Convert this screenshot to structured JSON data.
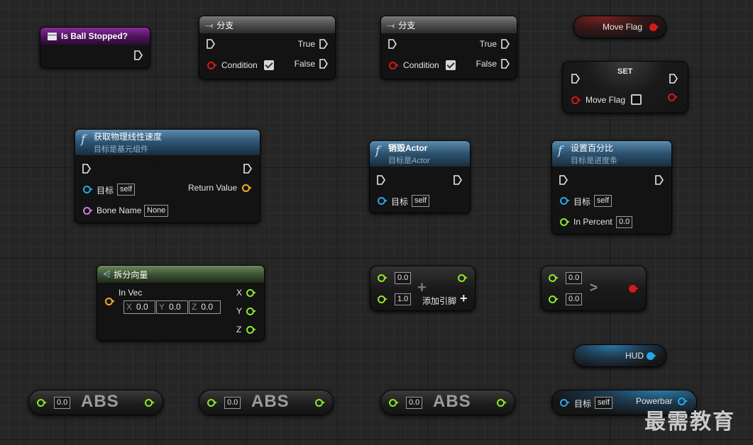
{
  "nodes": {
    "is_ball_stopped": {
      "title": "Is Ball Stopped?"
    },
    "branch1": {
      "title": "分支",
      "true_label": "True",
      "false_label": "False",
      "condition_label": "Condition"
    },
    "branch2": {
      "title": "分支",
      "true_label": "True",
      "false_label": "False",
      "condition_label": "Condition"
    },
    "move_flag_get": {
      "label": "Move Flag"
    },
    "set_move_flag": {
      "title": "SET",
      "var_label": "Move Flag"
    },
    "get_physics_velocity": {
      "title": "获取物理线性速度",
      "subtitle": "目标是基元组件",
      "target_label": "目标",
      "target_value": "self",
      "bone_label": "Bone Name",
      "bone_value": "None",
      "return_label": "Return Value"
    },
    "destroy_actor": {
      "title": "销毁Actor",
      "subtitle_prefix": "目标是",
      "subtitle_em": "Actor",
      "target_label": "目标",
      "target_value": "self"
    },
    "set_percent": {
      "title": "设置百分比",
      "subtitle": "目标是进度条",
      "target_label": "目标",
      "target_value": "self",
      "percent_label": "In Percent",
      "percent_value": "0.0"
    },
    "break_vector": {
      "title": "拆分向量",
      "invec_label": "In Vec",
      "x_label": "X",
      "x_value": "0.0",
      "y_label": "Y",
      "y_value": "0.0",
      "z_label": "Z",
      "z_value": "0.0",
      "out_x": "X",
      "out_y": "Y",
      "out_z": "Z"
    },
    "add_node": {
      "a_value": "0.0",
      "b_value": "1.0",
      "add_pin_label": "添加引脚",
      "add_icon": "+"
    },
    "greater_node": {
      "a_value": "0.0",
      "b_value": "0.0",
      "op": ">"
    },
    "hud_get": {
      "label": "HUD"
    },
    "abs1": {
      "value": "0.0",
      "label": "ABS"
    },
    "abs2": {
      "value": "0.0",
      "label": "ABS"
    },
    "abs3": {
      "value": "0.0",
      "label": "ABS"
    },
    "powerbar": {
      "target_label": "目标",
      "target_value": "self",
      "out_label": "Powerbar"
    }
  },
  "watermark": "最需教育"
}
